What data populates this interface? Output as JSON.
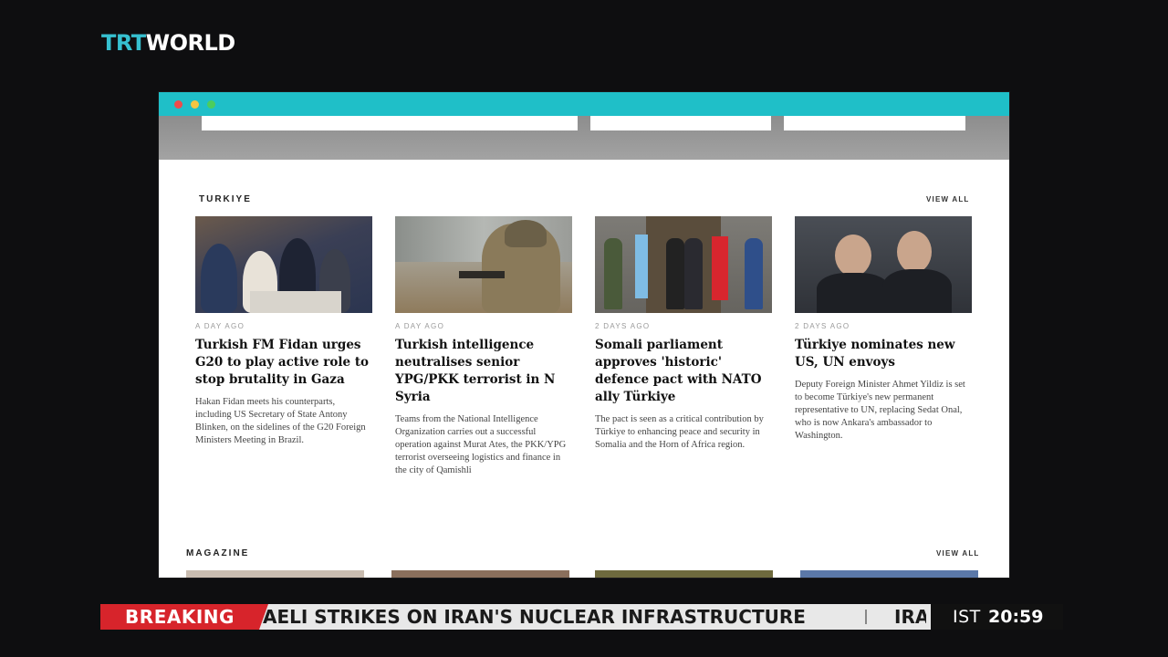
{
  "brand": {
    "logo_trt": "TRT",
    "logo_world": "WORLD"
  },
  "colors": {
    "accent": "#1fbfc8",
    "breaking": "#d7242b",
    "logo_cyan": "#36c0d0"
  },
  "browser": {
    "controls": [
      "close",
      "minimize",
      "maximize"
    ]
  },
  "turkiye_section": {
    "title": "TURKIYE",
    "view_all": "VIEW ALL",
    "cards": [
      {
        "ago": "A DAY AGO",
        "headline": "Turkish FM Fidan urges G20 to play active role to stop brutality in Gaza",
        "summary": "Hakan Fidan meets his counterparts, including US Secretary of State Antony Blinken, on the sidelines of the G20 Foreign Ministers Meeting in Brazil."
      },
      {
        "ago": "A DAY AGO",
        "headline": "Turkish intelligence neutralises senior YPG/PKK terrorist in N Syria",
        "summary": "Teams from the National Intelligence Organization carries out a successful operation against Murat Ates, the PKK/YPG terrorist overseeing logistics and finance in the city of Qamishli"
      },
      {
        "ago": "2 DAYS AGO",
        "headline": "Somali parliament approves 'historic' defence pact with NATO ally Türkiye",
        "summary": "The pact is seen as a critical contribution by Türkiye to enhancing peace and security in Somalia and the Horn of Africa region."
      },
      {
        "ago": "2 DAYS AGO",
        "headline": "Türkiye nominates new US, UN envoys",
        "summary": "Deputy Foreign Minister Ahmet Yildiz is set to become Türkiye's new permanent representative to UN, replacing Sedat Onal, who is now Ankara's ambassador to Washington."
      }
    ]
  },
  "magazine_section": {
    "title": "MAGAZINE",
    "view_all": "VIEW ALL"
  },
  "ticker": {
    "label": "BREAKING",
    "text": "AELI STRIKES ON IRAN'S NUCLEAR INFRASTRUCTURE",
    "next_text": "IRA",
    "clock_zone": "IST",
    "clock_time": "20:59"
  }
}
